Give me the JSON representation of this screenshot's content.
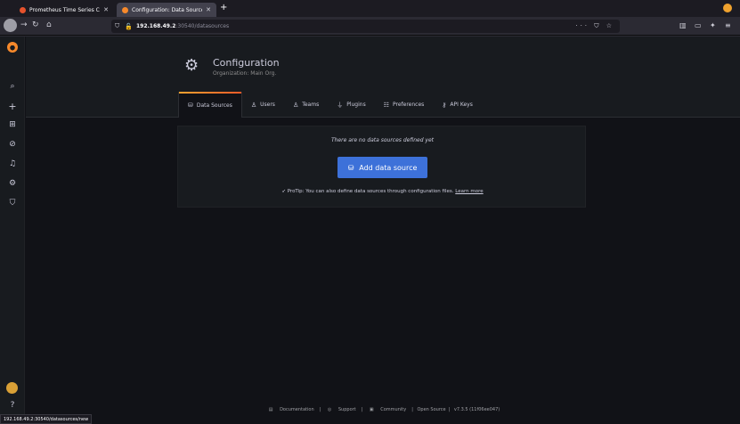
{
  "browser": {
    "tabs": [
      {
        "title": "Prometheus Time Series C",
        "active": false,
        "favicon_color": "#e6522c"
      },
      {
        "title": "Configuration: Data Source",
        "active": true,
        "favicon_color": "#f7892b"
      }
    ],
    "new_tab": "+",
    "url": {
      "host": "192.168.49.2",
      "path": ":30540/datasources"
    },
    "status_url": "192.168.49.2:30540/datasources/new"
  },
  "sidemenu": {
    "icons": [
      "grafana-logo-icon",
      "search-icon",
      "plus-icon",
      "dashboards-icon",
      "explore-icon",
      "alerting-icon",
      "configuration-icon",
      "server-admin-icon",
      "avatar",
      "help-icon"
    ]
  },
  "header": {
    "title": "Configuration",
    "subtitle": "Organization: Main Org.",
    "tabs": [
      {
        "label": "Data Sources",
        "icon": "database-icon",
        "active": true
      },
      {
        "label": "Users",
        "icon": "user-icon",
        "active": false
      },
      {
        "label": "Teams",
        "icon": "users-icon",
        "active": false
      },
      {
        "label": "Plugins",
        "icon": "plug-icon",
        "active": false
      },
      {
        "label": "Preferences",
        "icon": "sliders-icon",
        "active": false
      },
      {
        "label": "API Keys",
        "icon": "key-icon",
        "active": false
      }
    ]
  },
  "empty_state": {
    "title": "There are no data sources defined yet",
    "button": "Add data source",
    "protip": "ProTip: You can also define data sources through configuration files.",
    "protip_link": "Learn more"
  },
  "footer": {
    "documentation": "Documentation",
    "support": "Support",
    "community": "Community",
    "open_source": "Open Source",
    "version": "v7.3.5 (11f06ee047)"
  },
  "colors": {
    "primary_button": "#3d71d9",
    "accent_gradient_start": "#f8a230",
    "accent_gradient_end": "#f05a28",
    "background": "#111217"
  }
}
